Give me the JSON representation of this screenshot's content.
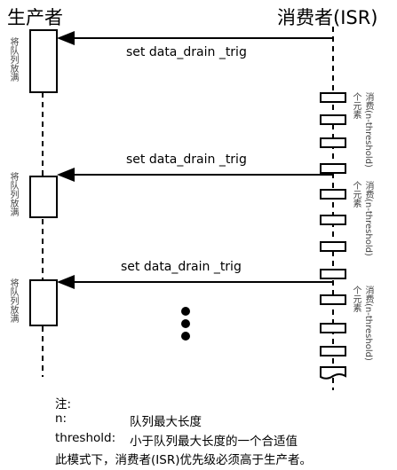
{
  "producer": {
    "title": "生产者",
    "action": "将队列放满"
  },
  "consumer": {
    "title": "消费者(ISR)",
    "action_a": "个元素",
    "action_b": "消费(n-threshold)"
  },
  "signal": "set data_drain _trig",
  "notes": {
    "title": "注:",
    "n_key": "n:",
    "n_val": "队列最大长度",
    "th_key": "threshold:",
    "th_val": "小于队列最大长度的一个合适值",
    "line3": "此模式下，消费者(ISR)优先级必须高于生产者。"
  }
}
